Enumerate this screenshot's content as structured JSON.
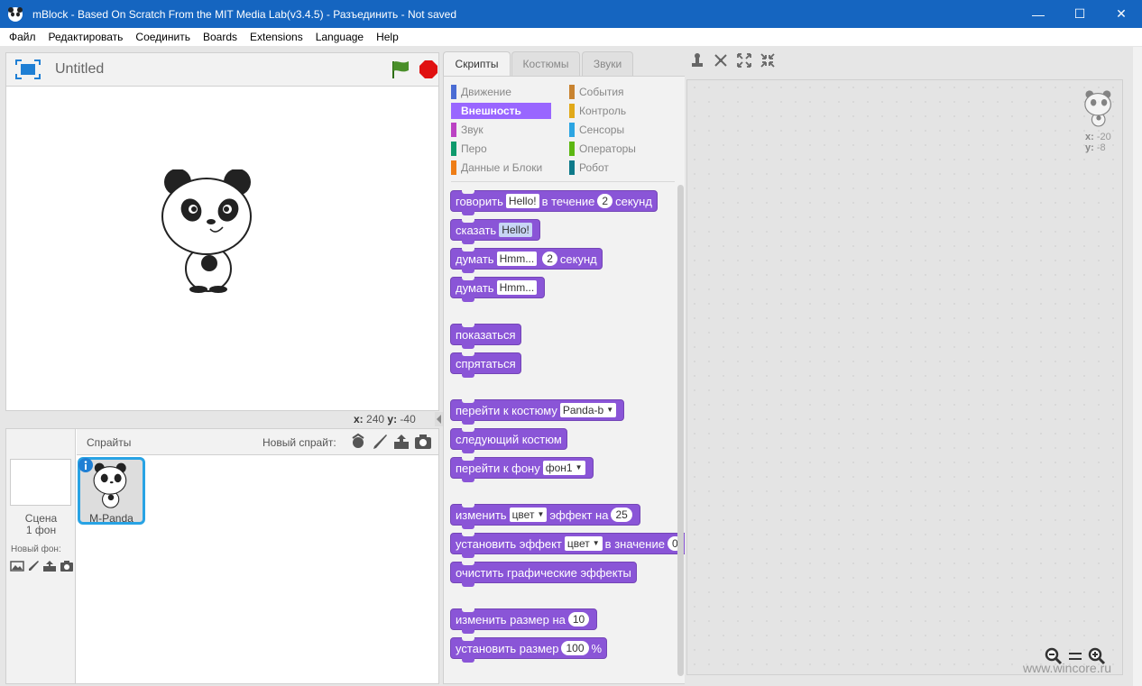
{
  "window": {
    "title": "mBlock - Based On Scratch From the MIT Media Lab(v3.4.5) - Разъединить - Not saved",
    "minimize": "—",
    "maximize": "☐",
    "close": "✕"
  },
  "menu": [
    "Файл",
    "Редактировать",
    "Соединить",
    "Boards",
    "Extensions",
    "Language",
    "Help"
  ],
  "stage": {
    "project_title": "Untitled",
    "x_label": "x:",
    "x_value": "240",
    "y_label": "y:",
    "y_value": "-40"
  },
  "sprites_pane": {
    "title": "Спрайты",
    "new_sprite_label": "Новый спрайт:",
    "scene_label": "Сцена",
    "scene_count": "1 фон",
    "new_bg_label": "Новый фон:",
    "sprite_name": "M-Panda"
  },
  "tabs": [
    "Скрипты",
    "Костюмы",
    "Звуки"
  ],
  "categories": [
    {
      "label": "Движение",
      "color": "#4a6cd4"
    },
    {
      "label": "Внешность",
      "color": "#8a55d7"
    },
    {
      "label": "Звук",
      "color": "#bb42c3"
    },
    {
      "label": "Перо",
      "color": "#0e9a6c"
    },
    {
      "label": "Данные и Блоки",
      "color": "#ee7d16"
    },
    {
      "label": "События",
      "color": "#c88330"
    },
    {
      "label": "Контроль",
      "color": "#e1a91a"
    },
    {
      "label": "Сенсоры",
      "color": "#2ca5e2"
    },
    {
      "label": "Операторы",
      "color": "#5cb712"
    },
    {
      "label": "Робот",
      "color": "#0e7a8a"
    }
  ],
  "blocks": {
    "say_for": {
      "t1": "говорить",
      "s1": "Hello!",
      "t2": "в течение",
      "n1": "2",
      "t3": "секунд"
    },
    "say": {
      "t1": "сказать",
      "s1": "Hello!"
    },
    "think_for": {
      "t1": "думать",
      "s1": "Hmm...",
      "n1": "2",
      "t2": "секунд"
    },
    "think": {
      "t1": "думать",
      "s1": "Hmm..."
    },
    "show": "показаться",
    "hide": "спрятаться",
    "switch_costume": {
      "t1": "перейти к костюму",
      "d1": "Panda-b"
    },
    "next_costume": "следующий костюм",
    "switch_backdrop": {
      "t1": "перейти к фону",
      "d1": "фон1"
    },
    "change_effect": {
      "t1": "изменить",
      "d1": "цвет",
      "t2": "эффект на",
      "n1": "25"
    },
    "set_effect": {
      "t1": "установить эффект",
      "d1": "цвет",
      "t2": "в значение",
      "n1": "0"
    },
    "clear_effects": "очистить графические эффекты",
    "change_size": {
      "t1": "изменить размер на",
      "n1": "10"
    },
    "set_size": {
      "t1": "установить размер",
      "n1": "100",
      "t2": "%"
    }
  },
  "scripts_area": {
    "x_label": "x:",
    "x_value": "-20",
    "y_label": "y:",
    "y_value": "-8"
  },
  "watermark": "www.wincore.ru",
  "colors": {
    "titlebar": "#1565c0",
    "looks": "#8a55d7",
    "selection": "#28a3e4",
    "flag": "#4a8f2a",
    "stop": "#e01010"
  }
}
